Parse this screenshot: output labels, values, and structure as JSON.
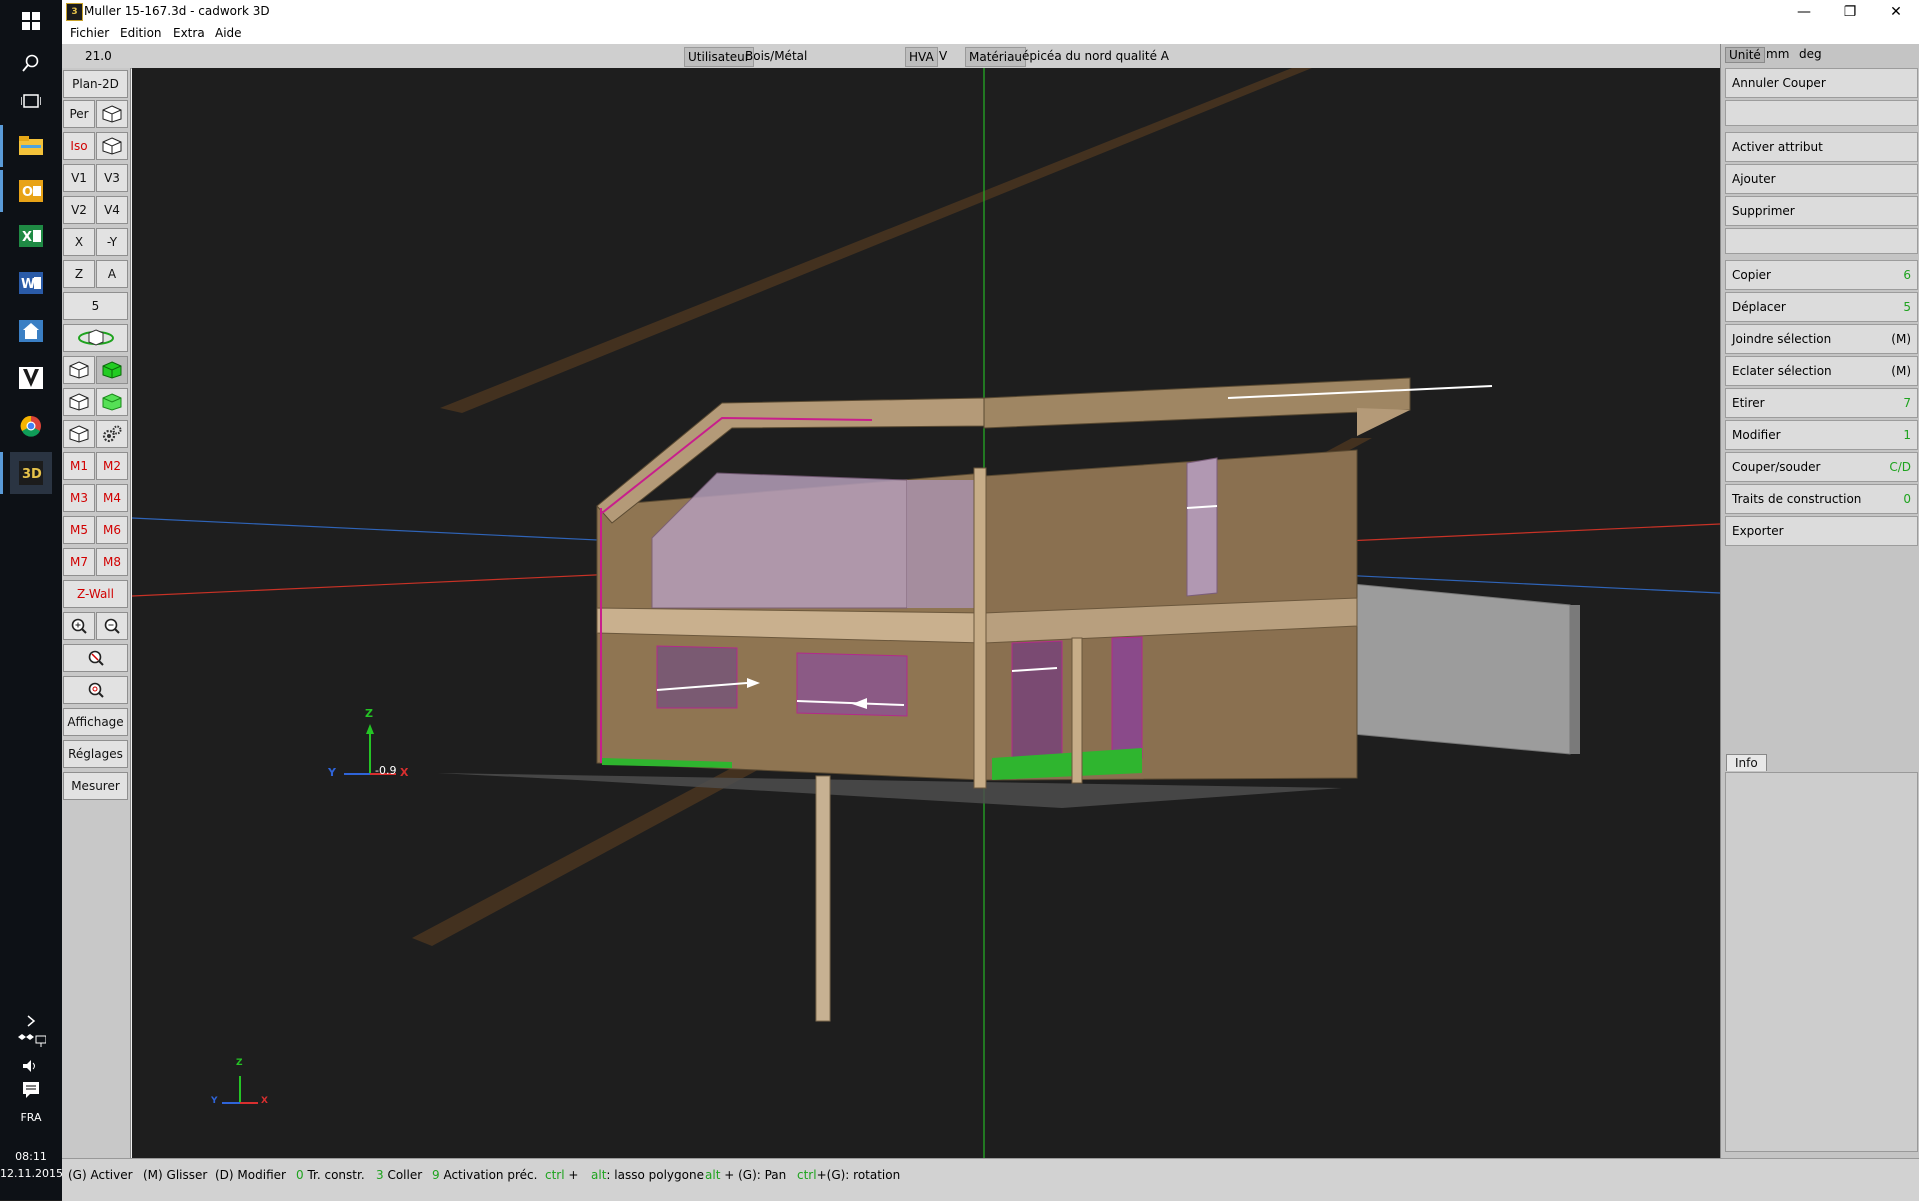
{
  "window": {
    "title": "Muller 15-167.3d - cadwork 3D",
    "app_icon_text": "3",
    "controls": {
      "minimize": "—",
      "restore": "❐",
      "close": "✕"
    }
  },
  "menu": [
    "Fichier",
    "Edition",
    "Extra",
    "Aide"
  ],
  "infobar": {
    "version": "21.0",
    "user_label": "Utilisateur",
    "user_value": "Bois/Métal",
    "hva": "HVA",
    "v": "V",
    "material_label": "Matériau",
    "material_value": "épicéa du nord qualité A",
    "unit_label": "Unité",
    "unit_length": "mm",
    "unit_angle": "deg"
  },
  "left_toolbar": {
    "plan2d": "Plan-2D",
    "per": "Per",
    "iso": "Iso",
    "v1": "V1",
    "v3": "V3",
    "v2": "V2",
    "v4": "V4",
    "x": "X",
    "my": "-Y",
    "z": "Z",
    "a": "A",
    "five": "5",
    "red_rows": [
      [
        "M1",
        "M2"
      ],
      [
        "M3",
        "M4"
      ],
      [
        "M5",
        "M6"
      ],
      [
        "M7",
        "M8"
      ]
    ],
    "red_wide": "Z-Wall",
    "affichage": "Affichage",
    "reglages": "Réglages",
    "mesurer": "Mesurer"
  },
  "right_panel": {
    "buttons": [
      {
        "label": "Annuler Couper",
        "key": ""
      },
      {
        "label": "Activer attribut",
        "key": ""
      },
      {
        "label": "Ajouter",
        "key": ""
      },
      {
        "label": "Supprimer",
        "key": ""
      },
      {
        "label": "Copier",
        "key": "6"
      },
      {
        "label": "Déplacer",
        "key": "5"
      },
      {
        "label": "Joindre sélection",
        "key": "(M)"
      },
      {
        "label": "Eclater sélection",
        "key": "(M)"
      },
      {
        "label": "Etirer",
        "key": "7"
      },
      {
        "label": "Modifier",
        "key": "1"
      },
      {
        "label": "Couper/souder",
        "key": "C/D"
      },
      {
        "label": "Traits de construction",
        "key": "0"
      },
      {
        "label": "Exporter",
        "key": ""
      }
    ],
    "info_tab": "Info"
  },
  "viewport": {
    "axis_z": "Z",
    "axis_y": "Y",
    "axis_x": "X",
    "small_axis_z": "Z",
    "small_axis_y": "Y",
    "small_axis_x": "X",
    "coord_readout": "-0.9"
  },
  "statusbar": [
    {
      "key": "",
      "text": "(G) Activer"
    },
    {
      "key": "",
      "text": "(M) Glisser"
    },
    {
      "key": "",
      "text": "(D) Modifier"
    },
    {
      "key": "0",
      "text": " Tr. constr."
    },
    {
      "key": "3",
      "text": " Coller"
    },
    {
      "key": "9",
      "text": " Activation préc."
    },
    {
      "key": "ctrl",
      "text": " +"
    },
    {
      "key": "alt",
      "text": ": lasso polygone"
    },
    {
      "key": "alt",
      "text": " + (G): Pan"
    },
    {
      "key": "ctrl",
      "text": "+(G): rotation"
    }
  ],
  "taskbar": {
    "language": "FRA",
    "time": "08:11",
    "date": "12.11.2015"
  },
  "colors": {
    "accent_green": "#1ea31e",
    "red_button_text": "#d10000",
    "viewport_bg": "#1e1e1e"
  }
}
